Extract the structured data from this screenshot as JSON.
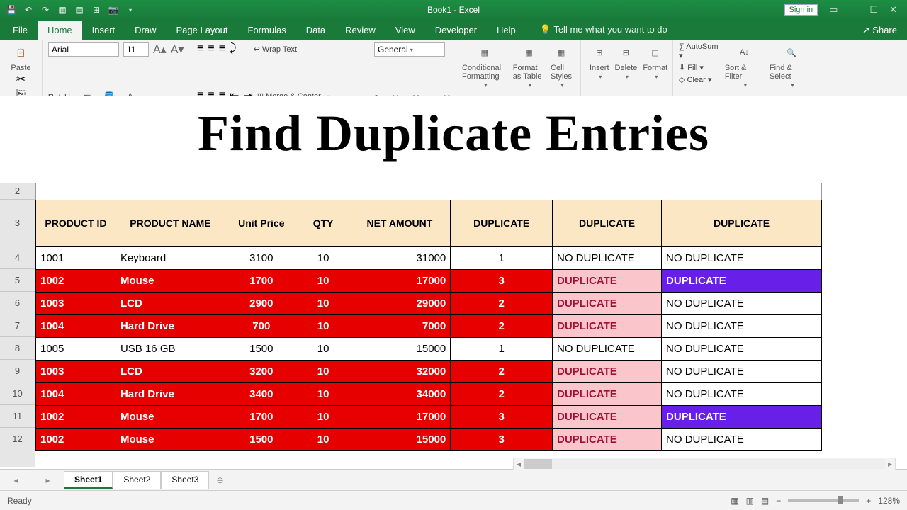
{
  "title": "Book1 - Excel",
  "signin": "Sign in",
  "tabs": [
    "File",
    "Home",
    "Insert",
    "Draw",
    "Page Layout",
    "Formulas",
    "Data",
    "Review",
    "View",
    "Developer",
    "Help"
  ],
  "active_tab": 1,
  "tell_me": "Tell me what you want to do",
  "share": "Share",
  "font": {
    "name": "Arial",
    "size": "11"
  },
  "wrap": "Wrap Text",
  "merge": "Merge & Center",
  "numfmt": "General",
  "styles": {
    "cf": "Conditional Formatting",
    "fat": "Format as Table",
    "cs": "Cell Styles"
  },
  "cells": {
    "ins": "Insert",
    "del": "Delete",
    "fmt": "Format"
  },
  "editing": {
    "as": "AutoSum",
    "fill": "Fill",
    "clr": "Clear",
    "sf": "Sort & Filter",
    "fs": "Find & Select"
  },
  "hero": "Find Duplicate Entries",
  "headers": [
    "PRODUCT ID",
    "PRODUCT NAME",
    "Unit Price",
    "QTY",
    "NET AMOUNT",
    "DUPLICATE",
    "DUPLICATE",
    "DUPLICATE"
  ],
  "row_nums": [
    "2",
    "3",
    "4",
    "5",
    "6",
    "7",
    "8",
    "9",
    "10",
    "11",
    "12"
  ],
  "rows": [
    {
      "id": "1001",
      "name": "Keyboard",
      "price": "3100",
      "qty": "10",
      "net": "31000",
      "d1": "1",
      "d2": "NO DUPLICATE",
      "d3": "NO DUPLICATE",
      "red": false,
      "pink": false,
      "purp": false
    },
    {
      "id": "1002",
      "name": "Mouse",
      "price": "1700",
      "qty": "10",
      "net": "17000",
      "d1": "3",
      "d2": "DUPLICATE",
      "d3": "DUPLICATE",
      "red": true,
      "pink": true,
      "purp": true
    },
    {
      "id": "1003",
      "name": "LCD",
      "price": "2900",
      "qty": "10",
      "net": "29000",
      "d1": "2",
      "d2": "DUPLICATE",
      "d3": "NO DUPLICATE",
      "red": true,
      "pink": true,
      "purp": false
    },
    {
      "id": "1004",
      "name": "Hard Drive",
      "price": "700",
      "qty": "10",
      "net": "7000",
      "d1": "2",
      "d2": "DUPLICATE",
      "d3": "NO DUPLICATE",
      "red": true,
      "pink": true,
      "purp": false
    },
    {
      "id": "1005",
      "name": "USB 16 GB",
      "price": "1500",
      "qty": "10",
      "net": "15000",
      "d1": "1",
      "d2": "NO DUPLICATE",
      "d3": "NO DUPLICATE",
      "red": false,
      "pink": false,
      "purp": false
    },
    {
      "id": "1003",
      "name": "LCD",
      "price": "3200",
      "qty": "10",
      "net": "32000",
      "d1": "2",
      "d2": "DUPLICATE",
      "d3": "NO DUPLICATE",
      "red": true,
      "pink": true,
      "purp": false
    },
    {
      "id": "1004",
      "name": "Hard Drive",
      "price": "3400",
      "qty": "10",
      "net": "34000",
      "d1": "2",
      "d2": "DUPLICATE",
      "d3": "NO DUPLICATE",
      "red": true,
      "pink": true,
      "purp": false
    },
    {
      "id": "1002",
      "name": "Mouse",
      "price": "1700",
      "qty": "10",
      "net": "17000",
      "d1": "3",
      "d2": "DUPLICATE",
      "d3": "DUPLICATE",
      "red": true,
      "pink": true,
      "purp": true
    },
    {
      "id": "1002",
      "name": "Mouse",
      "price": "1500",
      "qty": "10",
      "net": "15000",
      "d1": "3",
      "d2": "DUPLICATE",
      "d3": "NO DUPLICATE",
      "red": true,
      "pink": true,
      "purp": false
    }
  ],
  "sheets": [
    "Sheet1",
    "Sheet2",
    "Sheet3"
  ],
  "active_sheet": 0,
  "status": "Ready",
  "zoom": "128%"
}
